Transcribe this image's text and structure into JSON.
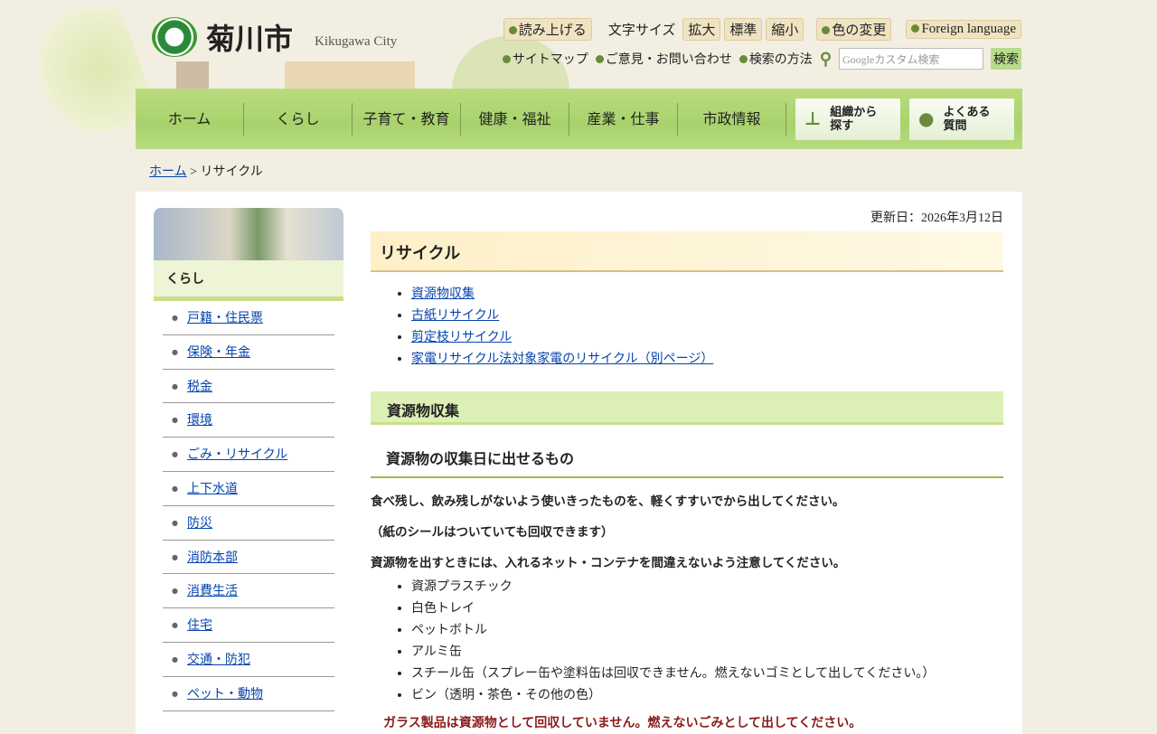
{
  "header": {
    "logo": "菊川市",
    "logo_en": "Kikugawa City"
  },
  "util": {
    "read": "読み上げる",
    "font_size": "文字サイズ",
    "enlarge": "拡大",
    "standard": "標準",
    "shrink": "縮小",
    "color": "色の変更",
    "foreign": "Foreign language",
    "sitemap": "サイトマップ",
    "contact": "ご意見・お問い合わせ",
    "search_method": "検索の方法",
    "search_placeholder": "Googleカスタム検索",
    "search_button": "検索"
  },
  "nav": {
    "items": [
      "ホーム",
      "くらし",
      "子育て・教育",
      "健康・福祉",
      "産業・仕事",
      "市政情報"
    ],
    "org": "組織から探す",
    "faq": "よくある質問"
  },
  "breadcrumb": {
    "home": "ホーム",
    "sep": " > ",
    "current": "リサイクル"
  },
  "sidebar": {
    "title": "くらし",
    "items": [
      "戸籍・住民票",
      "保険・年金",
      "税金",
      "環境",
      "ごみ・リサイクル",
      "上下水道",
      "防災",
      "消防本部",
      "消費生活",
      "住宅",
      "交通・防犯",
      "ペット・動物"
    ]
  },
  "content": {
    "updated": "更新日：2026年3月12日",
    "title": "リサイクル",
    "toc": [
      "資源物収集",
      "古紙リサイクル",
      "剪定枝リサイクル",
      "家電リサイクル法対象家電のリサイクル（別ページ）"
    ],
    "h2": "資源物収集",
    "h3": "資源物の収集日に出せるもの",
    "p1": "食べ残し、飲み残しがないよう使いきったものを、軽くすすいでから出してください。",
    "p2": "（紙のシールはついていても回収できます）",
    "p3": "資源物を出すときには、入れるネット・コンテナを間違えないよう注意してください。",
    "items": [
      "資源プラスチック",
      "白色トレイ",
      "ペットボトル",
      "アルミ缶",
      "スチール缶（スプレー缶や塗料缶は回収できません。燃えないゴミとして出してください。）",
      "ビン（透明・茶色・その他の色）"
    ],
    "warning": "ガラス製品は資源物として回収していません。燃えないごみとして出してください。"
  }
}
